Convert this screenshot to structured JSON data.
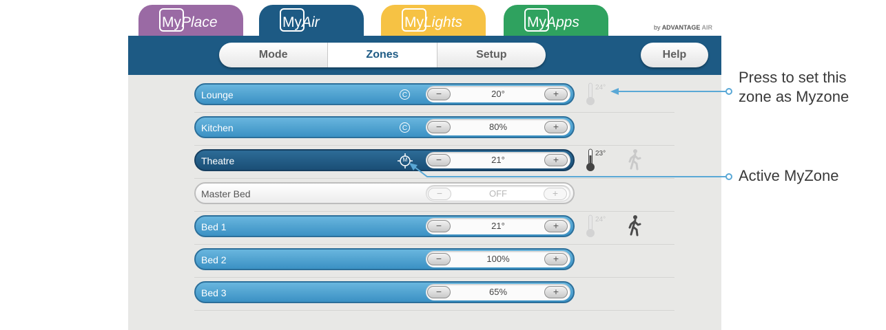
{
  "app_tabs": [
    {
      "prefix": "My",
      "suffix": "Place",
      "color": "#9a6aa4"
    },
    {
      "prefix": "My",
      "suffix": "Air",
      "color": "#1d5a84"
    },
    {
      "prefix": "My",
      "suffix": "Lights",
      "color": "#f6c244"
    },
    {
      "prefix": "My",
      "suffix": "Apps",
      "color": "#2fa25f"
    }
  ],
  "brand": {
    "by": "by",
    "name": "ADVANTAGE",
    "air": "AIR"
  },
  "nav": {
    "tabs": [
      "Mode",
      "Zones",
      "Setup"
    ],
    "active": "Zones",
    "help": "Help"
  },
  "zones": [
    {
      "name": "Lounge",
      "value": "20°",
      "temp": "24°",
      "constant": "C"
    },
    {
      "name": "Kitchen",
      "value": "80%",
      "constant": "C"
    },
    {
      "name": "Theatre",
      "value": "21°",
      "temp": "23°",
      "myzone": "M"
    },
    {
      "name": "Master Bed",
      "value": "OFF"
    },
    {
      "name": "Bed 1",
      "value": "21°",
      "temp": "24°"
    },
    {
      "name": "Bed 2",
      "value": "100%"
    },
    {
      "name": "Bed 3",
      "value": "65%"
    }
  ],
  "buttons": {
    "minus": "−",
    "plus": "+"
  },
  "annotations": {
    "set_myzone_line1": "Press to set this",
    "set_myzone_line2": "zone as Myzone",
    "active_myzone": "Active MyZone"
  },
  "colors": {
    "nav": "#1d5a84",
    "zone_bar": "#4aa3d4",
    "active_zone": "#1e5a86",
    "annotation_line": "#5aa8d6"
  }
}
